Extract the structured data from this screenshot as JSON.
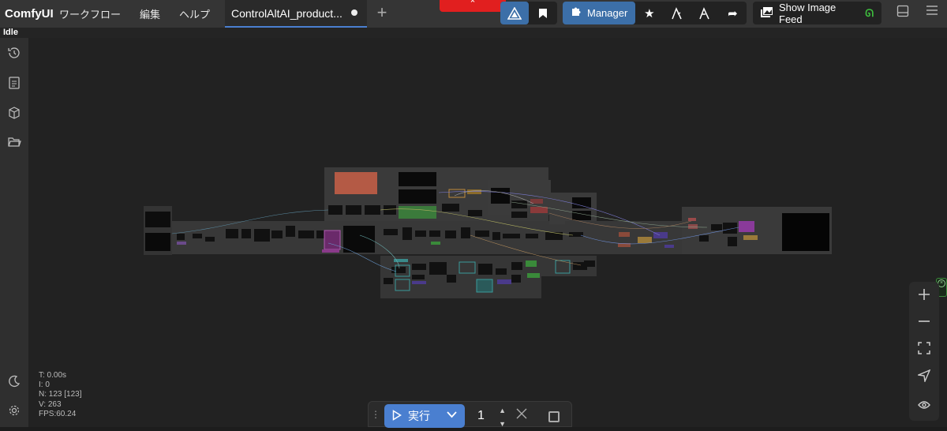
{
  "app": {
    "name": "ComfyUI"
  },
  "menu": [
    "ワークフロー",
    "編集",
    "ヘルプ"
  ],
  "tab": {
    "title": "ControlAltAI_product..."
  },
  "toolbar": {
    "manager_label": "Manager",
    "feed_label": "Show Image Feed"
  },
  "status": "Idle",
  "stats": {
    "t": "T: 0.00s",
    "i": "I: 0",
    "n": "N: 123 [123]",
    "v": "V: 263",
    "fps": "FPS:60.24"
  },
  "run": {
    "label": "実行",
    "batch_count": "1"
  },
  "colors": {
    "accent": "#4a7fd0",
    "topbar": "#353535",
    "canvas": "#222222",
    "alert": "#e11f1f"
  },
  "icons": {
    "sidebar": [
      "history-icon",
      "queue-icon",
      "model-library-icon",
      "workflows-icon",
      "theme-toggle-icon",
      "settings-icon"
    ],
    "zoom": [
      "zoom-in-icon",
      "zoom-out-icon",
      "fit-view-icon",
      "locate-icon",
      "visibility-icon"
    ]
  }
}
